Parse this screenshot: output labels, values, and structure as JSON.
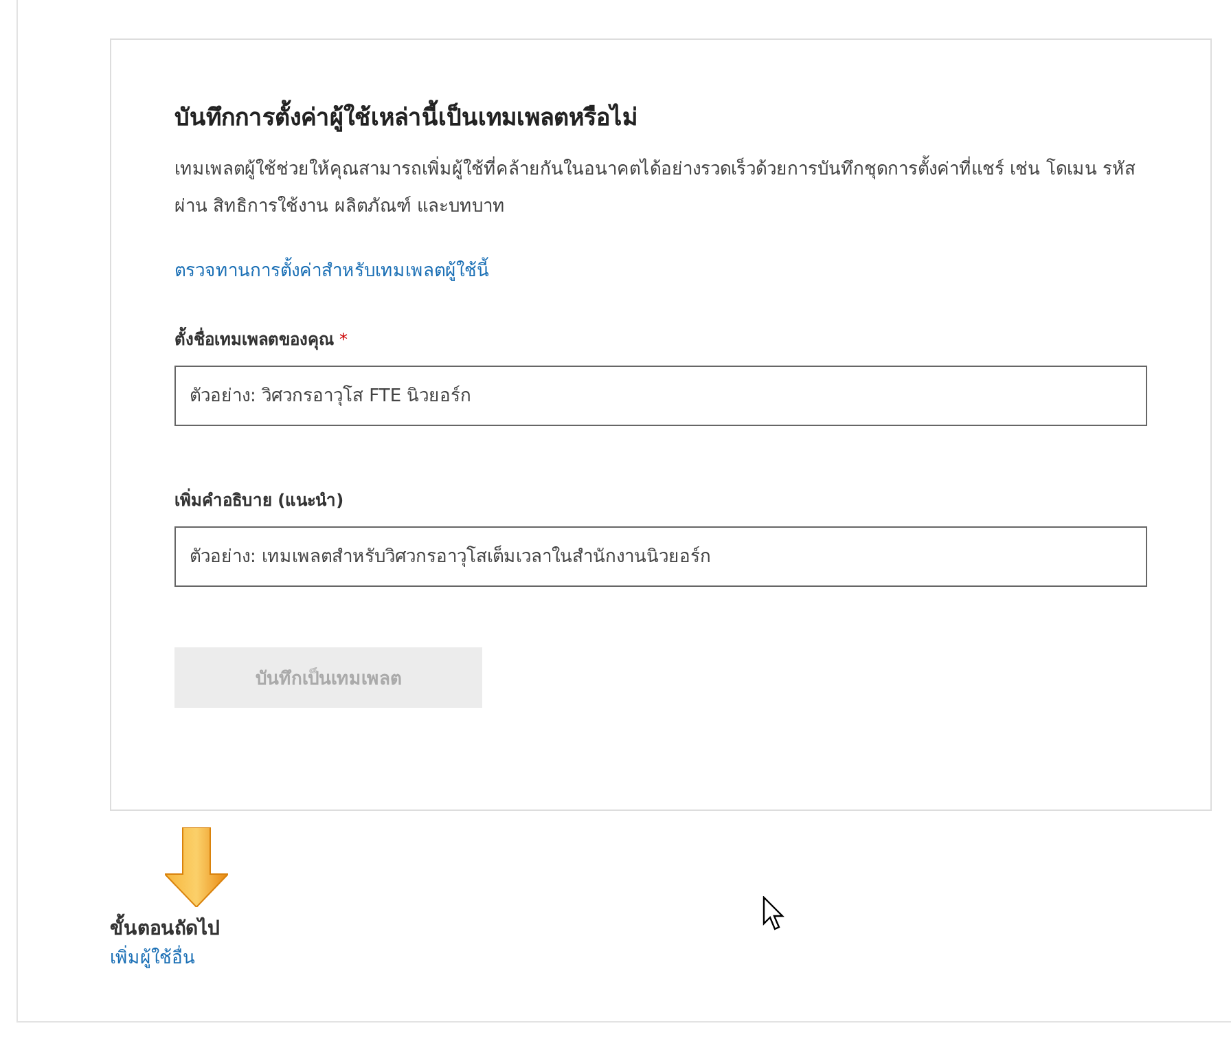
{
  "card": {
    "title": "บันทึกการตั้งค่าผู้ใช้เหล่านี้เป็นเทมเพลตหรือไม่",
    "description": "เทมเพลตผู้ใช้ช่วยให้คุณสามารถเพิ่มผู้ใช้ที่คล้ายกันในอนาคตได้อย่างรวดเร็วด้วยการบันทึกชุดการตั้งค่าที่แชร์ เช่น โดเมน รหัสผ่าน สิทธิการใช้งาน ผลิตภัณฑ์ และบทบาท",
    "review_link": "ตรวจทานการตั้งค่าสำหรับเทมเพลตผู้ใช้นี้",
    "fields": [
      {
        "label": "ตั้งชื่อเทมเพลตของคุณ",
        "required_mark": "*",
        "placeholder": "ตัวอย่าง: วิศวกรอาวุโส FTE นิวยอร์ก"
      },
      {
        "label": "เพิ่มคำอธิบาย (แนะนำ)",
        "placeholder": "ตัวอย่าง: เทมเพลตสำหรับวิศวกรอาวุโสเต็มเวลาในสำนักงานนิวยอร์ก"
      }
    ],
    "save_button": {
      "label": "บันทึกเป็นเทมเพลต",
      "disabled": true
    }
  },
  "next_steps": {
    "heading": "ขั้นตอนถัดไป",
    "link": "เพิ่มผู้ใช้อื่น"
  }
}
